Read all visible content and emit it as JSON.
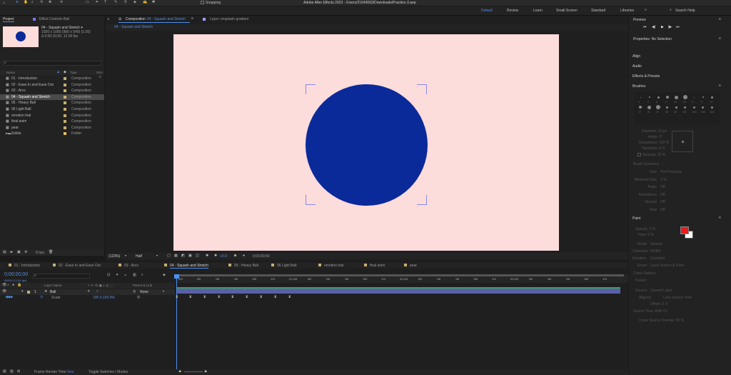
{
  "window": {
    "title": "Adobe After Effects 2023 - /Users/21643693/Downloads/Practice-3.aep"
  },
  "toolbar": {
    "snapping_label": "Snapping"
  },
  "workspaces": [
    "Default",
    "Review",
    "Learn",
    "Small Screen",
    "Standard",
    "Libraries"
  ],
  "search": {
    "placeholder": "Search Help"
  },
  "project": {
    "tab": "Project",
    "effect_tab": "Effect Controls Ball",
    "selected_name": "04 - Squash and Stretch ▾",
    "selected_info1": "1920 x 1080 (960 x 540) (1.00)",
    "selected_info2": "Δ 0;00;10;00, 12.00 fps",
    "columns": {
      "name": "Name",
      "type": "Type",
      "size": "Size"
    },
    "items": [
      {
        "name": "01 - Introduction",
        "type": "Composition",
        "color": "#c8b070"
      },
      {
        "name": "02 - Ease In and Ease Out",
        "type": "Composition",
        "color": "#c8b070"
      },
      {
        "name": "03 - Arcs",
        "type": "Composition",
        "color": "#c8b070"
      },
      {
        "name": "04 - Squash and Stretch",
        "type": "Composition",
        "color": "#c8b070"
      },
      {
        "name": "05 - Heavy Ball",
        "type": "Composition",
        "color": "#c8b070"
      },
      {
        "name": "06 Light Ball",
        "type": "Composition",
        "color": "#c8b070"
      },
      {
        "name": "emotion trial",
        "type": "Composition",
        "color": "#c8b070"
      },
      {
        "name": "final anim",
        "type": "Composition",
        "color": "#c8b070"
      },
      {
        "name": "pear",
        "type": "Composition",
        "color": "#c8b070"
      },
      {
        "name": "Solids",
        "type": "Folder",
        "color": "#e0c060"
      }
    ],
    "bpc": "8 bpc"
  },
  "composition": {
    "tab": "Composition",
    "tab_name": "04 - Squash and Stretch",
    "layer_tab": "Layer: imsplash gradient",
    "breadcrumb": "04 - Squash and Stretch",
    "bg_color": "#fddcdc",
    "ball_color": "#0a2a9a",
    "zoom": "(123%)",
    "resolution": "Half",
    "exposure": "+0.0",
    "timecode": "0;00;00;00"
  },
  "right_panel": {
    "preview": "Preview",
    "properties": "Properties: No Selection",
    "sections": [
      "Align",
      "Audio",
      "Effects & Presets",
      "Brushes"
    ],
    "brushes": {
      "sizes": [
        "1",
        "3",
        "5",
        "9",
        "13",
        "19",
        "5",
        "9",
        "13",
        "17",
        "21",
        "27",
        "35",
        "45",
        "65",
        "100",
        "200",
        "300"
      ],
      "diameter": "Diameter: 13 px",
      "angle": "Angle: 0°",
      "roundness": "Roundness: 100 %",
      "hardness": "Hardness: 0 %",
      "spacing": "Spacing: 25 %",
      "dynamics": "Brush Dynamics",
      "dyn": [
        {
          "label": "Size",
          "value": "Pen Pressure"
        },
        {
          "label": "Minimum Size",
          "value": "1 %"
        },
        {
          "label": "Angle",
          "value": "Off"
        },
        {
          "label": "Roundness",
          "value": "Off"
        },
        {
          "label": "Opacity",
          "value": "Off"
        },
        {
          "label": "Flow",
          "value": "Off"
        }
      ]
    },
    "paint": {
      "title": "Paint",
      "opacity": "Opacity: 0 %",
      "flow": "Flow: 0 %",
      "mode_label": "Mode:",
      "mode_value": "Normal",
      "channels_label": "Channels:",
      "channels_value": "RGBA",
      "duration_label": "Duration:",
      "duration_value": "Constant",
      "erase_label": "Erase:",
      "erase_value": "Layer Source & Paint",
      "clone_options": "Clone Options",
      "preset_label": "Preset:",
      "source_label": "Source:",
      "source_value": "Current Layer",
      "aligned": "Aligned",
      "lock_source": "Lock Source Time",
      "offset": "Offset: 0, 0",
      "source_time_shift": "Source Time Shift: 0 f",
      "clone_overlay": "Clone Source Overlay: 50 %",
      "fg_color": "#e81c1c"
    }
  },
  "timeline": {
    "tabs": [
      "01 - Introduction",
      "02 - Ease In and Ease Out",
      "03 - Arcs",
      "04 - Squash and Stretch",
      "05 - Heavy Ball",
      "06 Light Ball",
      "emotion trial",
      "final anim",
      "pear"
    ],
    "timecode": "0;00;00;00",
    "timecode_sub": "00000 (12.00 fps)",
    "columns": {
      "layer_name": "Layer Name",
      "parent": "Parent & Link"
    },
    "layer": {
      "number": "1",
      "name": "Ball",
      "parent": "None"
    },
    "property": {
      "name": "Scale",
      "value": "100.0,100.0%"
    },
    "ruler": [
      "00f",
      "02f",
      "04f",
      "06f",
      "08f",
      "10f",
      "01:00f",
      "02f",
      "04f",
      "06f",
      "08f",
      "10f",
      "02:00f",
      "02f",
      "04f",
      "06f",
      "08f",
      "10f",
      "03:00f",
      "02f",
      "04f",
      "06f",
      "08f",
      "10f"
    ],
    "footer_render": "Frame Render Time:",
    "footer_render_value": "1ms",
    "footer_toggle": "Toggle Switches / Modes"
  }
}
